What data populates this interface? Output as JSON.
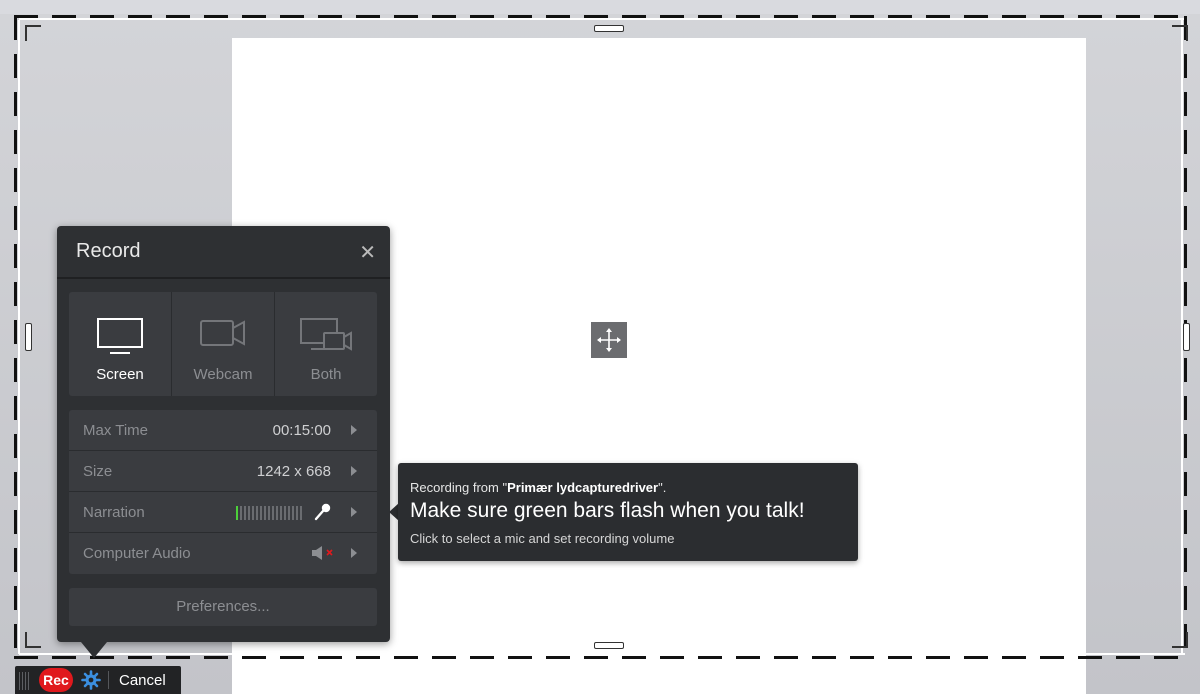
{
  "record_panel": {
    "title": "Record",
    "close_glyph": "✕",
    "modes": [
      {
        "label": "Screen",
        "icon": "monitor-icon",
        "active": true
      },
      {
        "label": "Webcam",
        "icon": "webcam-icon",
        "active": false
      },
      {
        "label": "Both",
        "icon": "screen-webcam-icon",
        "active": false
      }
    ],
    "settings": {
      "max_time": {
        "label": "Max Time",
        "value": "00:15:00"
      },
      "size": {
        "label": "Size",
        "value": "1242 x 668"
      },
      "narration": {
        "label": "Narration",
        "level": 0.03
      },
      "computer_audio": {
        "label": "Computer Audio",
        "muted": true
      }
    },
    "preferences_label": "Preferences..."
  },
  "tooltip": {
    "prefix": "Recording from \"",
    "device": "Primær lydcapturedriver",
    "suffix": "\".",
    "headline": "Make sure green bars flash when you talk!",
    "hint": "Click to select a mic and set recording volume"
  },
  "control_bar": {
    "rec_label": "Rec",
    "cancel_label": "Cancel"
  },
  "colors": {
    "panel_bg": "#2e3033",
    "rec_red": "#e0191d",
    "level_green": "#4ccf3a",
    "gear_blue": "#3b8fe0"
  }
}
